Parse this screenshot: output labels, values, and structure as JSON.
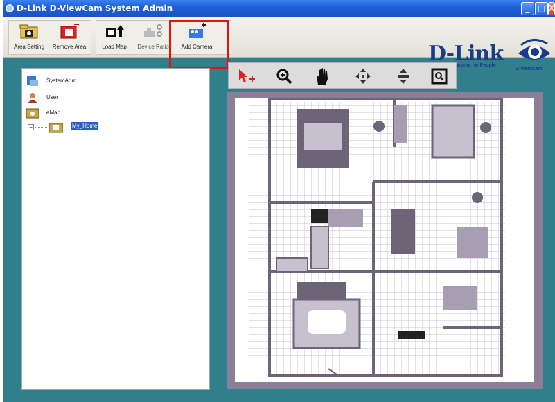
{
  "window": {
    "title": "D-Link D-ViewCam System Admin",
    "min_label": "_",
    "max_label": "□",
    "close_label": "X"
  },
  "toolbar": {
    "buttons": [
      {
        "label": "Area Setting",
        "icon": "area-setting-icon",
        "enabled": true
      },
      {
        "label": "Remove Area",
        "icon": "remove-area-icon",
        "enabled": true
      },
      {
        "label": "Load Map",
        "icon": "load-map-icon",
        "enabled": true
      },
      {
        "label": "Device Ratio",
        "icon": "device-ratio-icon",
        "enabled": false
      },
      {
        "label": "Add Camera",
        "icon": "add-camera-icon",
        "enabled": true,
        "highlighted": true
      }
    ]
  },
  "branding": {
    "logo_text": "D-Link",
    "tagline": "Building Networks for People",
    "product": "D-ViewCam"
  },
  "tree": {
    "items": [
      {
        "label": "SystemAdm",
        "icon": "system-admin-icon"
      },
      {
        "label": "User",
        "icon": "user-icon"
      },
      {
        "label": "eMap",
        "icon": "emap-icon"
      },
      {
        "label": "My_Home",
        "icon": "map-node-icon",
        "selected": true,
        "expander": "−"
      }
    ]
  },
  "map_tools": [
    {
      "name": "select-camera-tool",
      "icon": "pointer-add-icon"
    },
    {
      "name": "zoom-in-tool",
      "icon": "zoom-in-icon"
    },
    {
      "name": "pan-tool",
      "icon": "hand-icon"
    },
    {
      "name": "move-tool",
      "icon": "move-arrows-icon"
    },
    {
      "name": "fit-tool",
      "icon": "vertical-arrows-icon"
    },
    {
      "name": "zoom-box-tool",
      "icon": "zoom-box-icon"
    }
  ],
  "colors": {
    "background": "#2f7f8c",
    "highlight": "#e81010",
    "brand": "#1a3a8a",
    "floor_dark": "#6e6478",
    "floor_light": "#c7c0cf"
  }
}
